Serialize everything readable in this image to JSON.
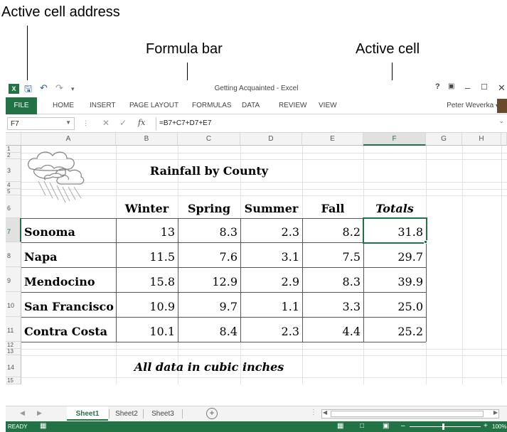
{
  "callouts": {
    "active_cell_address": "Active cell address",
    "formula_bar": "Formula bar",
    "active_cell": "Active cell"
  },
  "window": {
    "title": "Getting Acquainted - Excel",
    "help": "?",
    "user": "Peter Weverka"
  },
  "ribbon": {
    "tabs": [
      "FILE",
      "HOME",
      "INSERT",
      "PAGE LAYOUT",
      "FORMULAS",
      "DATA",
      "REVIEW",
      "VIEW"
    ]
  },
  "formula_bar": {
    "name_box": "F7",
    "fx": "fx",
    "formula": "=B7+C7+D7+E7"
  },
  "grid": {
    "columns": [
      "A",
      "B",
      "C",
      "D",
      "E",
      "F",
      "G",
      "H"
    ],
    "rows": [
      "1",
      "2",
      "3",
      "4",
      "5",
      "6",
      "7",
      "8",
      "9",
      "10",
      "11",
      "12",
      "13",
      "14",
      "15"
    ],
    "active_column": "F",
    "active_row": "7"
  },
  "sheet": {
    "title": "Rainfall by County",
    "headers": [
      "Winter",
      "Spring",
      "Summer",
      "Fall",
      "Totals"
    ],
    "rows": [
      {
        "county": "Sonoma",
        "values": [
          "13",
          "8.3",
          "2.3",
          "8.2"
        ],
        "total": "31.8"
      },
      {
        "county": "Napa",
        "values": [
          "11.5",
          "7.6",
          "3.1",
          "7.5"
        ],
        "total": "29.7"
      },
      {
        "county": "Mendocino",
        "values": [
          "15.8",
          "12.9",
          "2.9",
          "8.3"
        ],
        "total": "39.9"
      },
      {
        "county": "San Francisco",
        "values": [
          "10.9",
          "9.7",
          "1.1",
          "3.3"
        ],
        "total": "25.0"
      },
      {
        "county": "Contra Costa",
        "values": [
          "10.1",
          "8.4",
          "2.3",
          "4.4"
        ],
        "total": "25.2"
      }
    ],
    "footnote": "All data in cubic inches"
  },
  "sheet_tabs": [
    "Sheet1",
    "Sheet2",
    "Sheet3"
  ],
  "status": {
    "ready": "READY",
    "zoom": "100%"
  },
  "colors": {
    "excel_green": "#217346"
  }
}
